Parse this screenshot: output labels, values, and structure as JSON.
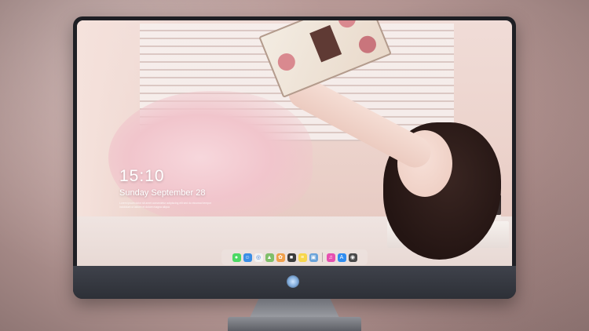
{
  "lockscreen": {
    "time": "15:10",
    "date": "Sunday September 28",
    "subtext": "Lorem ipsum dolor sit amet consectetur adipiscing elit sed do eiusmod tempor incididunt ut labore et dolore magna aliqua"
  },
  "dock": {
    "items": [
      {
        "name": "messages-icon",
        "color": "#4cd964",
        "glyph": "●"
      },
      {
        "name": "finder-icon",
        "color": "#3a8ee6",
        "glyph": "☺"
      },
      {
        "name": "safari-icon",
        "color": "#f2f2f2",
        "glyph": "◎"
      },
      {
        "name": "maps-icon",
        "color": "#7fbf6a",
        "glyph": "▲"
      },
      {
        "name": "photos-icon",
        "color": "#f0a04b",
        "glyph": "✿"
      },
      {
        "name": "clapper-icon",
        "color": "#3b3b3b",
        "glyph": "■"
      },
      {
        "name": "notes-icon",
        "color": "#f7d64c",
        "glyph": "≡"
      },
      {
        "name": "preview-icon",
        "color": "#6aa3d9",
        "glyph": "▣"
      },
      {
        "name": "itunes-icon",
        "color": "#e64fb0",
        "glyph": "♫"
      },
      {
        "name": "app-store-icon",
        "color": "#2f8cf0",
        "glyph": "A"
      },
      {
        "name": "camera-icon",
        "color": "#4a4a4a",
        "glyph": "◉"
      }
    ]
  },
  "colors": {
    "bezel": "#1e1f24",
    "chin": "#3f424b"
  }
}
